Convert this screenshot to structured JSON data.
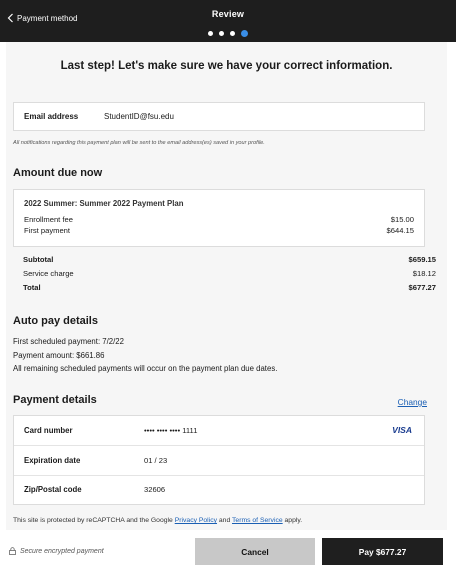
{
  "header": {
    "back_label": "Payment method",
    "title": "Review",
    "steps_total": 4,
    "steps_current": 4
  },
  "main": {
    "heading": "Last step! Let's make sure we have your correct information.",
    "email": {
      "label": "Email address",
      "value": "StudentID@fsu.edu"
    },
    "notification_note": "All notifications regarding this payment plan will be sent to the email address(es) saved in your profile.",
    "amount_due": {
      "title": "Amount due now",
      "plan_title": "2022 Summer: Summer 2022 Payment Plan",
      "items": [
        {
          "label": "Enrollment fee",
          "amount": "$15.00"
        },
        {
          "label": "First payment",
          "amount": "$644.15"
        }
      ],
      "subtotal_label": "Subtotal",
      "subtotal_value": "$659.15",
      "service_label": "Service charge",
      "service_value": "$18.12",
      "total_label": "Total",
      "total_value": "$677.27"
    },
    "autopay": {
      "title": "Auto pay details",
      "first_payment": "First scheduled payment: 7/2/22",
      "payment_amount": "Payment amount: $661.86",
      "remaining_note": "All remaining scheduled payments will occur on the payment plan due dates."
    },
    "payment_details": {
      "title": "Payment details",
      "change_label": "Change",
      "card_label": "Card number",
      "card_value": "•••• •••• •••• 1111",
      "card_brand": "VISA",
      "expiration_label": "Expiration date",
      "expiration_value": "01 / 23",
      "zip_label": "Zip/Postal code",
      "zip_value": "32606"
    },
    "recaptcha": {
      "prefix": "This site is protected by reCAPTCHA and the Google",
      "privacy_label": "Privacy Policy",
      "and": "and",
      "terms_label": "Terms of Service",
      "suffix": "apply."
    }
  },
  "footer": {
    "secure_label": "Secure encrypted payment",
    "cancel_label": "Cancel",
    "pay_label": "Pay $677.27"
  },
  "colors": {
    "header_bg": "#1e1e1e",
    "active_step": "#3a8ee6",
    "link": "#1a5fb4",
    "pay_button": "#1f1f1f",
    "cancel_button": "#c8c8c8"
  }
}
